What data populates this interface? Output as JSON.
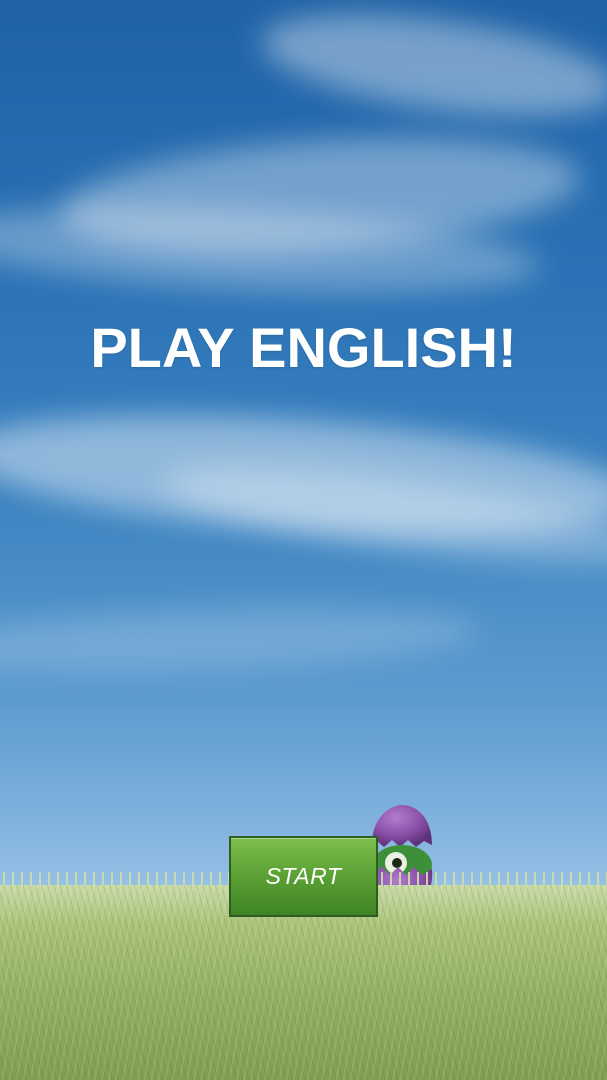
{
  "title": "PLAY ENGLISH!",
  "start_button": {
    "label": "START"
  },
  "colors": {
    "sky_top": "#1f62a6",
    "sky_bottom": "#c7ddef",
    "button_green": "#5ea336",
    "egg_purple": "#8a4fa8",
    "creature_green": "#3e8f3a"
  },
  "icons": {
    "character": "purple-egg-creature-icon"
  }
}
